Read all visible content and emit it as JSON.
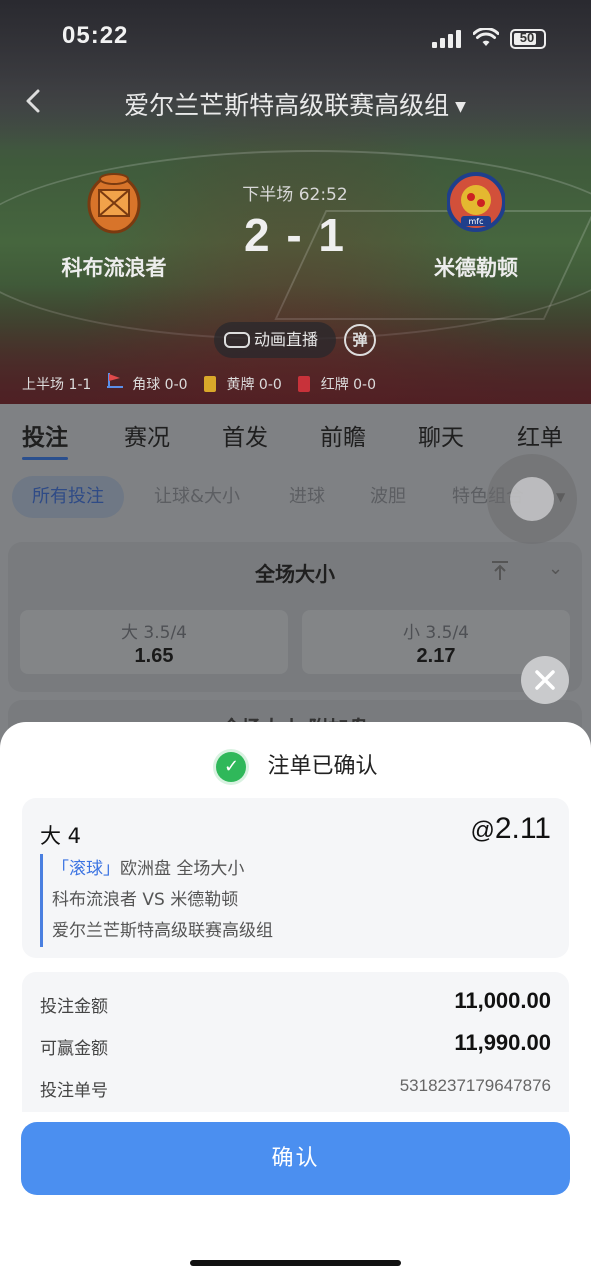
{
  "status_bar": {
    "time": "05:22",
    "battery": "50"
  },
  "header": {
    "league_title": "爱尔兰芒斯特高级联赛高级组"
  },
  "match": {
    "home_team": "科布流浪者",
    "away_team": "米德勒顿",
    "period": "下半场 62:52",
    "score": "2 - 1",
    "animation_button": "动画直播",
    "bullet_button": "弹",
    "stats": {
      "first_half": "上半场 1-1",
      "corners": "角球 0-0",
      "yellow_cards": "黄牌 0-0",
      "red_cards": "红牌 0-0"
    }
  },
  "main_tabs": [
    "投注",
    "赛况",
    "首发",
    "前瞻",
    "聊天",
    "红单"
  ],
  "sub_tabs": [
    "所有投注",
    "让球&大小",
    "进球",
    "波胆",
    "特色组合"
  ],
  "market": {
    "title": "全场大小",
    "over": {
      "label": "大 3.5/4",
      "odds": "1.65"
    },
    "under": {
      "label": "小 3.5/4",
      "odds": "2.17"
    },
    "next_title": "全场大小 附加盘"
  },
  "sheet": {
    "confirmed_text": "注单已确认",
    "selection": "大 4",
    "odds_prefix": "@",
    "odds": "2.11",
    "live_tag": "「滚球」",
    "market_desc": "欧洲盘 全场大小",
    "matchup": "科布流浪者 VS 米德勒顿",
    "league": "爱尔兰芒斯特高级联赛高级组",
    "stake_label": "投注金额",
    "stake_value": "11,000.00",
    "win_label": "可赢金额",
    "win_value": "11,990.00",
    "ticket_label": "投注单号",
    "ticket_value": "5318237179647876",
    "confirm_button": "确认"
  },
  "colors": {
    "accent": "#4b8ff0",
    "success": "#2fb85a",
    "live_tag": "#3c74e2",
    "yellow_card": "#d9a82a",
    "red_card": "#c8323a"
  }
}
